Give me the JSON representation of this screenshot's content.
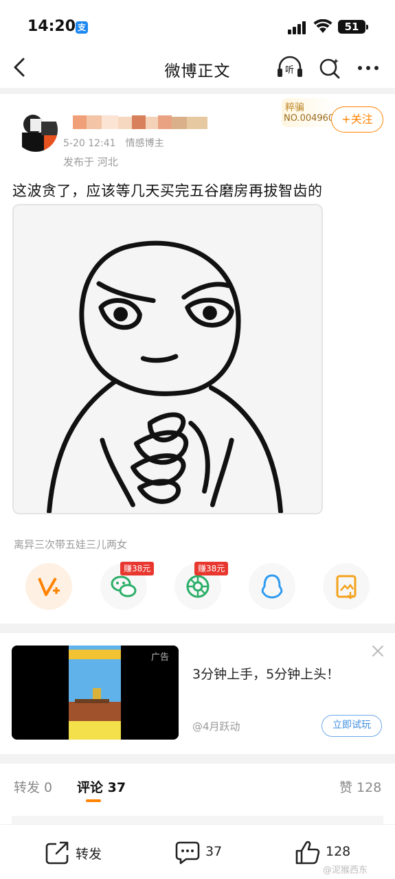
{
  "status": {
    "time": "14:20",
    "app_icon_char": "支",
    "battery": "51"
  },
  "nav": {
    "title": "微博正文",
    "listen_label": "听"
  },
  "post": {
    "meta_time": "5-20 12:41",
    "meta_tag": "情感博主",
    "location": "发布于 河北",
    "badge_title": "粹骗",
    "badge_no": "NO.004960",
    "follow_label": "+关注",
    "text": "这波贪了，应该等几天买完五谷磨房再拔智齿的",
    "source": "离异三次带五娃三儿两女"
  },
  "share": {
    "earn_tag_1": "赚38元",
    "earn_tag_2": "赚38元"
  },
  "ad": {
    "label": "广告",
    "text": "3分钟上手，5分钟上头！",
    "source": "@4月跃动",
    "button": "立即试玩"
  },
  "tabs": {
    "repost": "转发 0",
    "comment": "评论 37",
    "like": "赞 128"
  },
  "bottom": {
    "repost": "转发",
    "comment": "37",
    "like": "128"
  },
  "watermark": "@泥猴西东",
  "colors": {
    "accent": "#ff8200",
    "earn_red": "#e8372f",
    "link_blue": "#3f8ee0"
  }
}
